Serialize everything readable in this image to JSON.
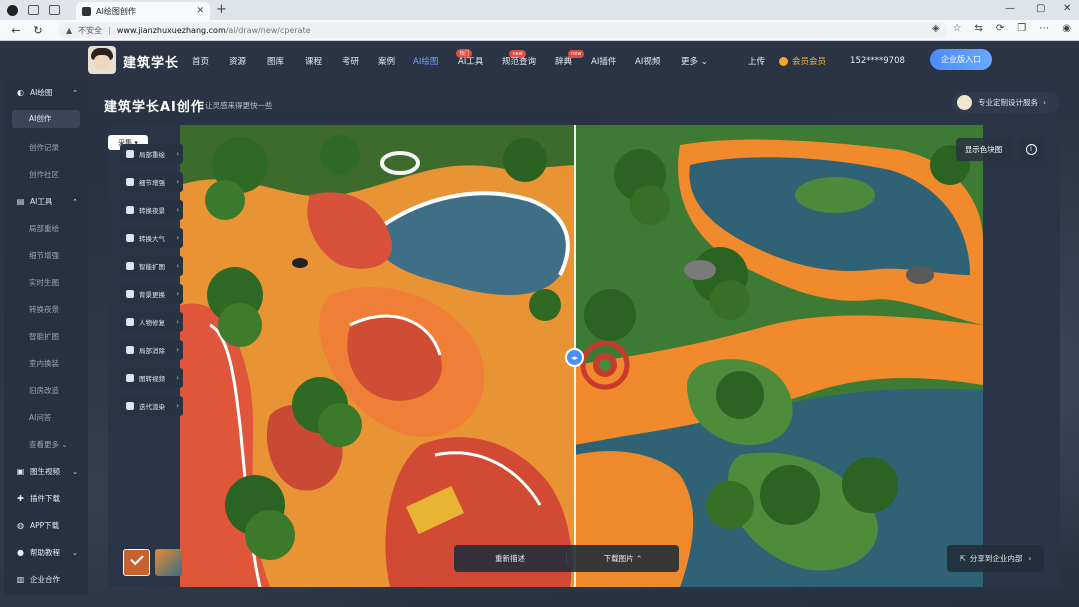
{
  "browser": {
    "tab_title": "AI绘图创作",
    "url_warning": "不安全",
    "url_host": "www.jianzhuxuezhang.com",
    "url_path": "/ai/draw/new/cperate"
  },
  "topnav": {
    "brand": "建筑学长",
    "menu": [
      {
        "label": "首页",
        "badge": ""
      },
      {
        "label": "资源",
        "badge": ""
      },
      {
        "label": "图库",
        "badge": ""
      },
      {
        "label": "课程",
        "badge": ""
      },
      {
        "label": "考研",
        "badge": ""
      },
      {
        "label": "案例",
        "badge": ""
      },
      {
        "label": "AI绘图",
        "badge": "热门"
      },
      {
        "label": "AI工具",
        "badge": "new"
      },
      {
        "label": "规范查询",
        "badge": "new"
      },
      {
        "label": "辞典",
        "badge": ""
      },
      {
        "label": "AI插件",
        "badge": ""
      },
      {
        "label": "AI视频",
        "badge": ""
      },
      {
        "label": "更多",
        "badge": ""
      }
    ],
    "upload": "上传",
    "vip": "会员会员",
    "phone": "152****9708",
    "enterprise_btn": "企业版入口"
  },
  "sidebar": {
    "groups": [
      {
        "label": "AI绘图",
        "icon": "palette-icon",
        "items": [
          "AI创作",
          "创作记录",
          "创作社区"
        ]
      },
      {
        "label": "AI工具",
        "icon": "tools-icon",
        "items": [
          "局部重绘",
          "细节增强",
          "实时生图",
          "转换夜景",
          "智能扩图",
          "室内换装",
          "旧房改造",
          "AI问答",
          "查看更多"
        ]
      },
      {
        "label": "图生视频",
        "icon": "video-icon",
        "items": []
      },
      {
        "label": "插件下载",
        "icon": "plugin-icon",
        "items": []
      },
      {
        "label": "APP下载",
        "icon": "app-icon",
        "items": []
      },
      {
        "label": "帮助教程",
        "icon": "help-icon",
        "items": []
      },
      {
        "label": "企业合作",
        "icon": "building-icon",
        "items": []
      }
    ]
  },
  "main": {
    "title": "建筑学长AI创作",
    "subtitle": "让灵感来得更快一些",
    "pro_service": "专业定制设计服务"
  },
  "canvas": {
    "collapse_label": "采集",
    "tools": [
      "局部重绘",
      "细节增强",
      "转换夜景",
      "转换大气",
      "智能扩图",
      "背景更换",
      "人物修复",
      "局部消除",
      "图转视频",
      "迭代渲染"
    ],
    "show_color": "显示色块图",
    "regenerate": "重新描述",
    "download": "下载图片",
    "share": "分享到企业内部"
  },
  "colors": {
    "accent": "#4a8eff",
    "path_orange": "#f29433",
    "path_red": "#e0563a",
    "water_blue": "#3c6d86",
    "grass_green": "#4f8b3a"
  }
}
